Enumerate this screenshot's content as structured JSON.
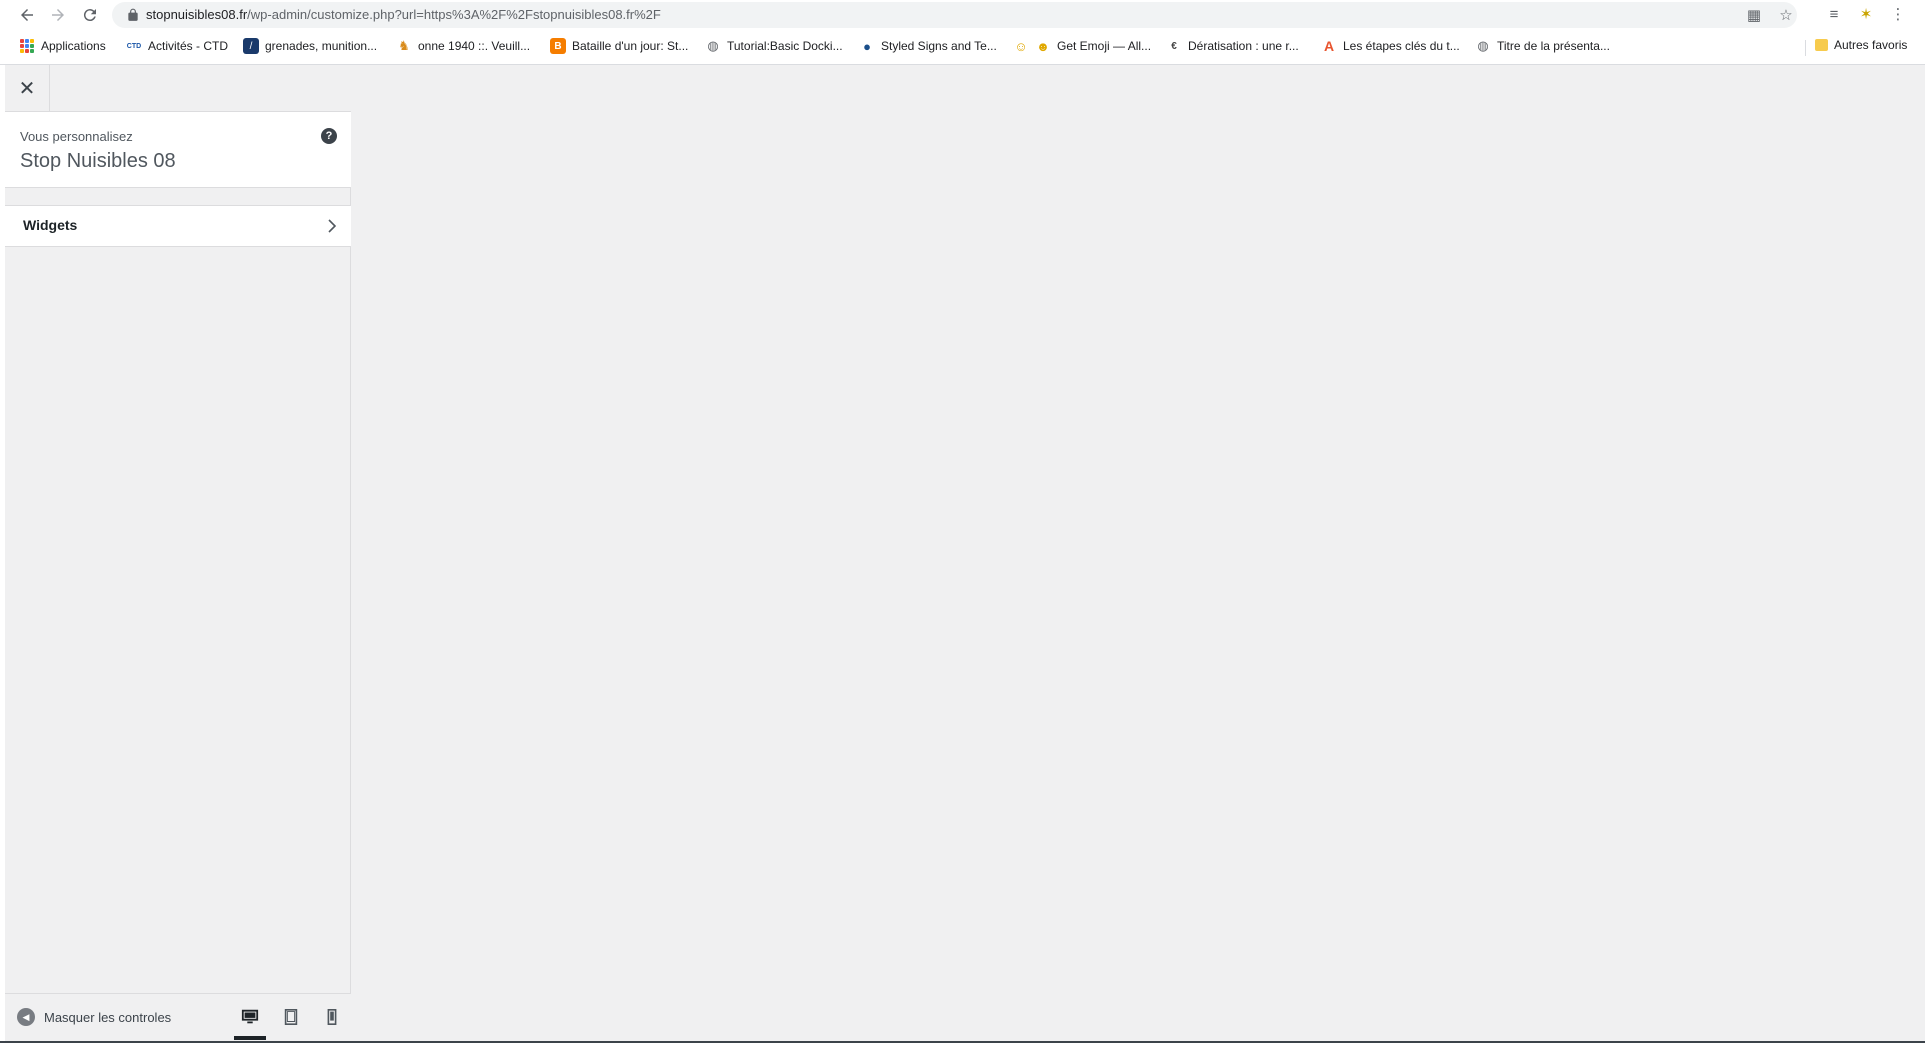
{
  "browser": {
    "url_host": "stopnuisibles08.fr",
    "url_path": "/wp-admin/customize.php?url=https%3A%2F%2Fstopnuisibles08.fr%2F",
    "bookmarks": [
      {
        "label": "Applications",
        "icon": "apps-grid-icon"
      },
      {
        "label": "Activités - CTD",
        "icon": "ctd-icon"
      },
      {
        "label": "grenades, munition...",
        "icon": "grenade-site-icon"
      },
      {
        "label": "onne 1940 ::. Veuill...",
        "icon": "soldier-icon"
      },
      {
        "label": "Bataille d'un jour: St...",
        "icon": "blogger-icon"
      },
      {
        "label": "Tutorial:Basic Docki...",
        "icon": "globe-icon"
      },
      {
        "label": "Styled Signs and Te...",
        "icon": "earth-icon"
      },
      {
        "label": "Get Emoji — All...",
        "icon": "emoji-icon"
      },
      {
        "label": "Dératisation : une r...",
        "icon": "c-logo-icon"
      },
      {
        "label": "Les étapes clés du t...",
        "icon": "a-logo-icon"
      },
      {
        "label": "Titre de la présenta...",
        "icon": "globe-icon"
      }
    ],
    "other_bookmarks": "Autres favoris"
  },
  "customizer": {
    "info_label": "Vous personnalisez",
    "site_title": "Stop Nuisibles 08",
    "sections": [
      {
        "label": "Widgets"
      }
    ],
    "collapse_label": "Masquer les controles",
    "preview_device": "desktop"
  },
  "colors": {
    "sidebar_bg": "#f0f0f1",
    "preview_bg": "#f0f0f1",
    "border": "#dcdcde",
    "text": "#1d2327"
  }
}
